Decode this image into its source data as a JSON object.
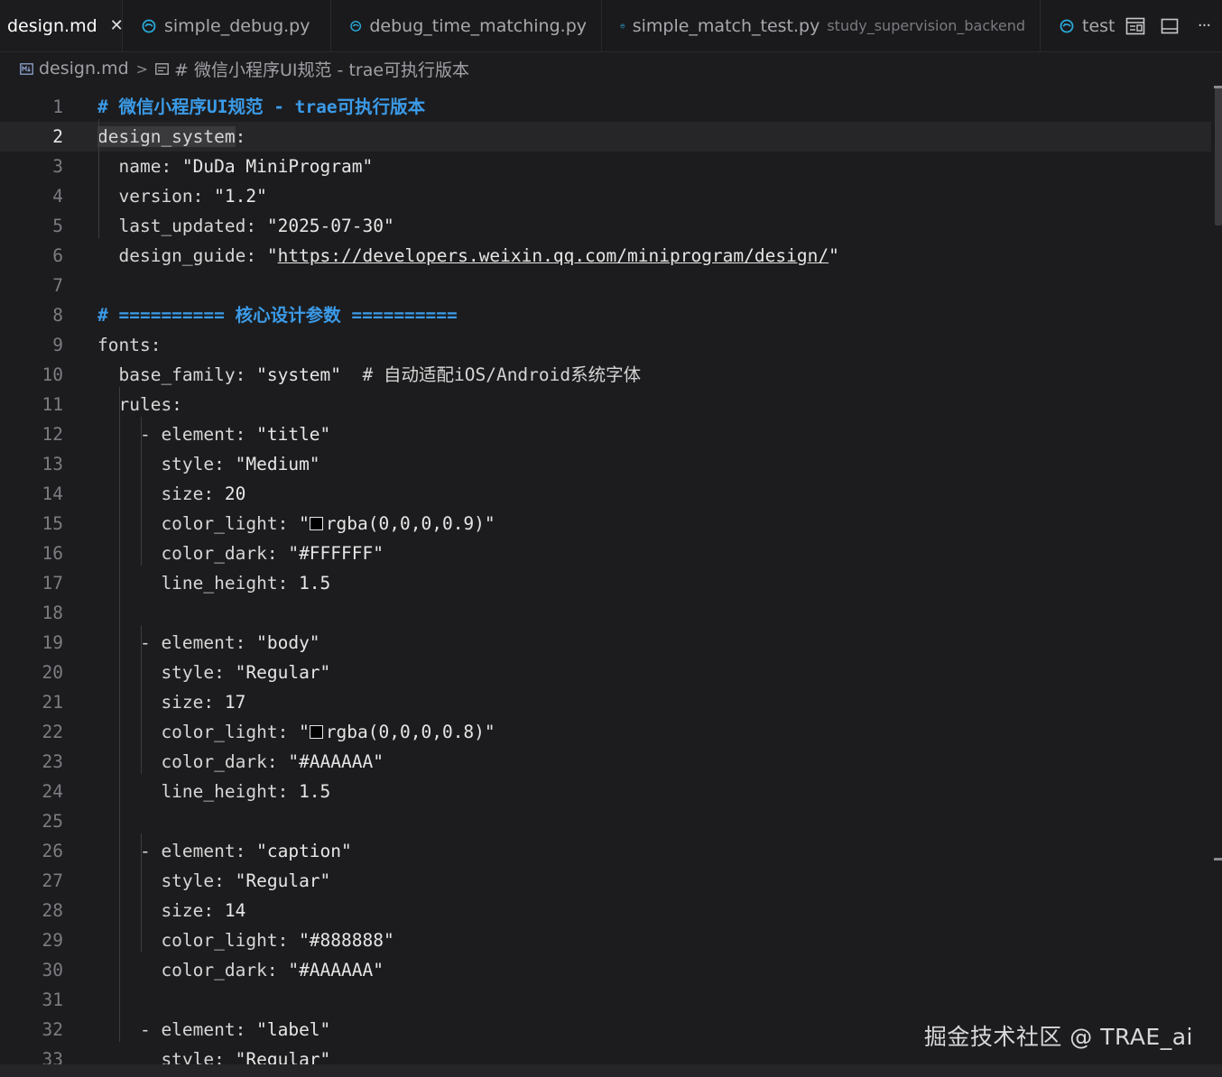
{
  "tabs": [
    {
      "label": "design.md",
      "active": true,
      "close": "✕"
    },
    {
      "label": "simple_debug.py"
    },
    {
      "label": "debug_time_matching.py"
    },
    {
      "label": "simple_match_test.py",
      "desc": "study_supervision_backend"
    },
    {
      "label": "test"
    }
  ],
  "tab_actions": [
    "layout-preview-icon",
    "split-editor-icon",
    "more-icon"
  ],
  "more_label": "···",
  "breadcrumb": {
    "file": "design.md",
    "separator": ">",
    "section": "# 微信小程序UI规范 - trae可执行版本"
  },
  "editor": {
    "current_line": 2,
    "lines": [
      {
        "n": "1",
        "parts": [
          {
            "t": "# 微信小程序UI规范 - trae可执行版本",
            "c": "tk-h"
          }
        ]
      },
      {
        "n": "2",
        "parts": [
          {
            "t": "design_system",
            "c": "tk-key tk-sel"
          },
          {
            "t": ":",
            "c": "tk-key"
          }
        ]
      },
      {
        "n": "3",
        "parts": [
          {
            "t": "  name: ",
            "c": "tk-key"
          },
          {
            "t": "\"DuDa MiniProgram\"",
            "c": "tk-str"
          }
        ]
      },
      {
        "n": "4",
        "parts": [
          {
            "t": "  version: ",
            "c": "tk-key"
          },
          {
            "t": "\"1.2\"",
            "c": "tk-str"
          }
        ]
      },
      {
        "n": "5",
        "parts": [
          {
            "t": "  last_updated: ",
            "c": "tk-key"
          },
          {
            "t": "\"2025-07-30\"",
            "c": "tk-str"
          }
        ]
      },
      {
        "n": "6",
        "parts": [
          {
            "t": "  design_guide: ",
            "c": "tk-key"
          },
          {
            "t": "\"",
            "c": "tk-str"
          },
          {
            "t": "https://developers.weixin.qq.com/miniprogram/design/",
            "c": "tk-str tk-link"
          },
          {
            "t": "\"",
            "c": "tk-str"
          }
        ]
      },
      {
        "n": "7",
        "parts": []
      },
      {
        "n": "8",
        "parts": [
          {
            "t": "# ========== 核心设计参数 ==========",
            "c": "tk-h"
          }
        ]
      },
      {
        "n": "9",
        "parts": [
          {
            "t": "fonts:",
            "c": "tk-key"
          }
        ]
      },
      {
        "n": "10",
        "parts": [
          {
            "t": "  base_family: ",
            "c": "tk-key"
          },
          {
            "t": "\"system\"",
            "c": "tk-str"
          },
          {
            "t": "  # 自动适配iOS/Android系统字体",
            "c": "tk-com"
          }
        ]
      },
      {
        "n": "11",
        "parts": [
          {
            "t": "  rules:",
            "c": "tk-key"
          }
        ]
      },
      {
        "n": "12",
        "parts": [
          {
            "t": "    - element: ",
            "c": "tk-key"
          },
          {
            "t": "\"title\"",
            "c": "tk-str"
          }
        ]
      },
      {
        "n": "13",
        "parts": [
          {
            "t": "      style: ",
            "c": "tk-key"
          },
          {
            "t": "\"Medium\"",
            "c": "tk-str"
          }
        ]
      },
      {
        "n": "14",
        "parts": [
          {
            "t": "      size: ",
            "c": "tk-key"
          },
          {
            "t": "20",
            "c": "tk-num"
          }
        ]
      },
      {
        "n": "15",
        "parts": [
          {
            "t": "      color_light: ",
            "c": "tk-key"
          },
          {
            "t": "\"",
            "c": "tk-str"
          },
          {
            "box": "#000000"
          },
          {
            "t": "rgba(0,0,0,0.9)\"",
            "c": "tk-str"
          }
        ]
      },
      {
        "n": "16",
        "parts": [
          {
            "t": "      color_dark: ",
            "c": "tk-key"
          },
          {
            "t": "\"#FFFFFF\"",
            "c": "tk-str"
          }
        ]
      },
      {
        "n": "17",
        "parts": [
          {
            "t": "      line_height: ",
            "c": "tk-key"
          },
          {
            "t": "1.5",
            "c": "tk-num"
          }
        ]
      },
      {
        "n": "18",
        "parts": []
      },
      {
        "n": "19",
        "parts": [
          {
            "t": "    - element: ",
            "c": "tk-key"
          },
          {
            "t": "\"body\"",
            "c": "tk-str"
          }
        ]
      },
      {
        "n": "20",
        "parts": [
          {
            "t": "      style: ",
            "c": "tk-key"
          },
          {
            "t": "\"Regular\"",
            "c": "tk-str"
          }
        ]
      },
      {
        "n": "21",
        "parts": [
          {
            "t": "      size: ",
            "c": "tk-key"
          },
          {
            "t": "17",
            "c": "tk-num"
          }
        ]
      },
      {
        "n": "22",
        "parts": [
          {
            "t": "      color_light: ",
            "c": "tk-key"
          },
          {
            "t": "\"",
            "c": "tk-str"
          },
          {
            "box": "#000000"
          },
          {
            "t": "rgba(0,0,0,0.8)\"",
            "c": "tk-str"
          }
        ]
      },
      {
        "n": "23",
        "parts": [
          {
            "t": "      color_dark: ",
            "c": "tk-key"
          },
          {
            "t": "\"#AAAAAA\"",
            "c": "tk-str"
          }
        ]
      },
      {
        "n": "24",
        "parts": [
          {
            "t": "      line_height: ",
            "c": "tk-key"
          },
          {
            "t": "1.5",
            "c": "tk-num"
          }
        ]
      },
      {
        "n": "25",
        "parts": []
      },
      {
        "n": "26",
        "parts": [
          {
            "t": "    - element: ",
            "c": "tk-key"
          },
          {
            "t": "\"caption\"",
            "c": "tk-str"
          }
        ]
      },
      {
        "n": "27",
        "parts": [
          {
            "t": "      style: ",
            "c": "tk-key"
          },
          {
            "t": "\"Regular\"",
            "c": "tk-str"
          }
        ]
      },
      {
        "n": "28",
        "parts": [
          {
            "t": "      size: ",
            "c": "tk-key"
          },
          {
            "t": "14",
            "c": "tk-num"
          }
        ]
      },
      {
        "n": "29",
        "parts": [
          {
            "t": "      color_light: ",
            "c": "tk-key"
          },
          {
            "t": "\"#888888\"",
            "c": "tk-str"
          }
        ]
      },
      {
        "n": "30",
        "parts": [
          {
            "t": "      color_dark: ",
            "c": "tk-key"
          },
          {
            "t": "\"#AAAAAA\"",
            "c": "tk-str"
          }
        ]
      },
      {
        "n": "31",
        "parts": []
      },
      {
        "n": "32",
        "parts": [
          {
            "t": "    - element: ",
            "c": "tk-key"
          },
          {
            "t": "\"label\"",
            "c": "tk-str"
          }
        ]
      },
      {
        "n": "33",
        "parts": [
          {
            "t": "      style: ",
            "c": "tk-key"
          },
          {
            "t": "\"Regular\"",
            "c": "tk-str"
          }
        ]
      }
    ]
  },
  "watermark": "掘金技术社区 @ TRAE_ai",
  "colors": {
    "background": "#1c1c1e",
    "heading": "#3b9be8",
    "text": "#d4d4d4",
    "line_number": "#7c7c82",
    "python_icon": "#2aa9d8"
  }
}
